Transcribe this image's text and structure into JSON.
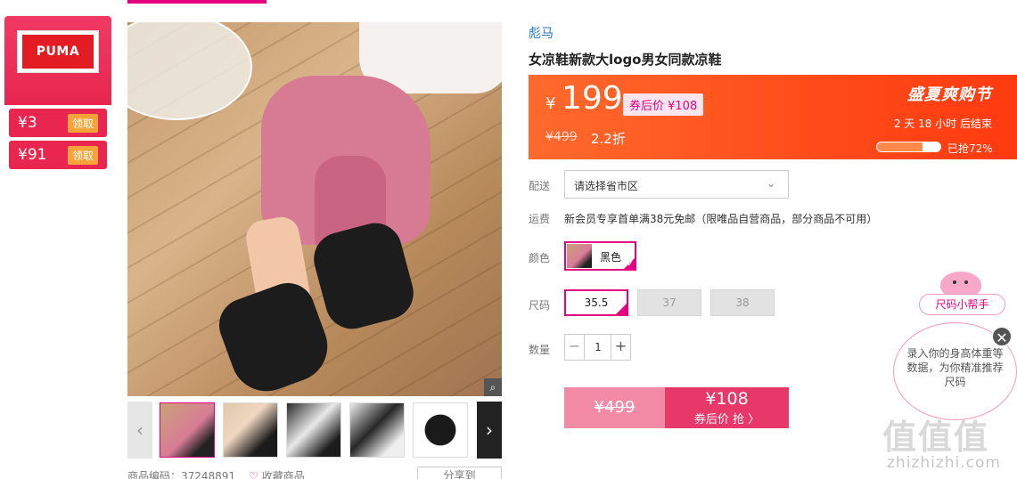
{
  "brand_card": {
    "logo_text": "PUMA",
    "coupons": [
      {
        "amount": "¥3",
        "action": "领取"
      },
      {
        "amount": "¥91",
        "action": "领取"
      }
    ]
  },
  "product": {
    "brand": "彪马",
    "title": "女凉鞋新款大logo男女同款凉鞋"
  },
  "price_banner": {
    "currency": "¥",
    "price": "199",
    "after_coupon": "券后价 ¥108",
    "original_price": "¥499",
    "discount": "2.2折",
    "event_name": "盛夏爽购节",
    "countdown": "2 天 18 小时 后结束",
    "progress_fraction": 0.72,
    "progress_text": "已抢72%"
  },
  "shipping": {
    "label": "配送",
    "value": "请选择省市区"
  },
  "freight": {
    "label": "运费",
    "text": "新会员专享首单满38元免邮（限唯品自营商品，部分商品不可用）"
  },
  "color": {
    "label": "颜色",
    "selected": "黑色"
  },
  "size": {
    "label": "尺码",
    "options": [
      "35.5",
      "37",
      "38"
    ],
    "selected": "35.5"
  },
  "quantity": {
    "label": "数量",
    "minus": "−",
    "plus": "+",
    "value": "1"
  },
  "buy": {
    "original": "¥499",
    "price": "¥108",
    "cta": "券后价 抢 〉"
  },
  "size_helper": {
    "button": "尺码小帮手",
    "bubble": "录入你的身高体重等数据，为你精准推荐尺码",
    "close": "✕"
  },
  "below_image": {
    "code_label": "商品编码：37248891",
    "favorite": "收藏商品",
    "share": "分享到"
  },
  "watermark": {
    "logo": "值值值",
    "url": "zhizhizhi.com"
  }
}
